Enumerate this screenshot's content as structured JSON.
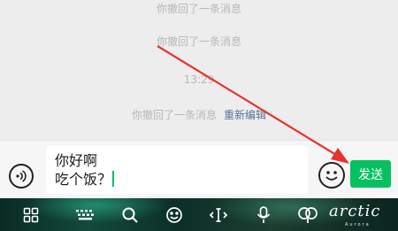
{
  "chat": {
    "recall_1": "你撤回了一条消息",
    "recall_2": "你撤回了一条消息",
    "timestamp": "13:29",
    "recall_3": "你撤回了一条消息",
    "reedit_link": "重新编辑"
  },
  "input": {
    "line_1": "你好啊",
    "line_2": "吃个饭？"
  },
  "send_label": "发送",
  "keyboard": {
    "icons": [
      "grid-icon",
      "keyboard-icon",
      "search-icon",
      "emoji-icon",
      "cursor-move-icon",
      "microphone-icon",
      "skin-theme-icon"
    ],
    "brand": "arctic",
    "brand_sub": "Aurora"
  },
  "colors": {
    "accent": "#07c160",
    "arrow": "#e8322d",
    "link": "#5a6f95"
  }
}
